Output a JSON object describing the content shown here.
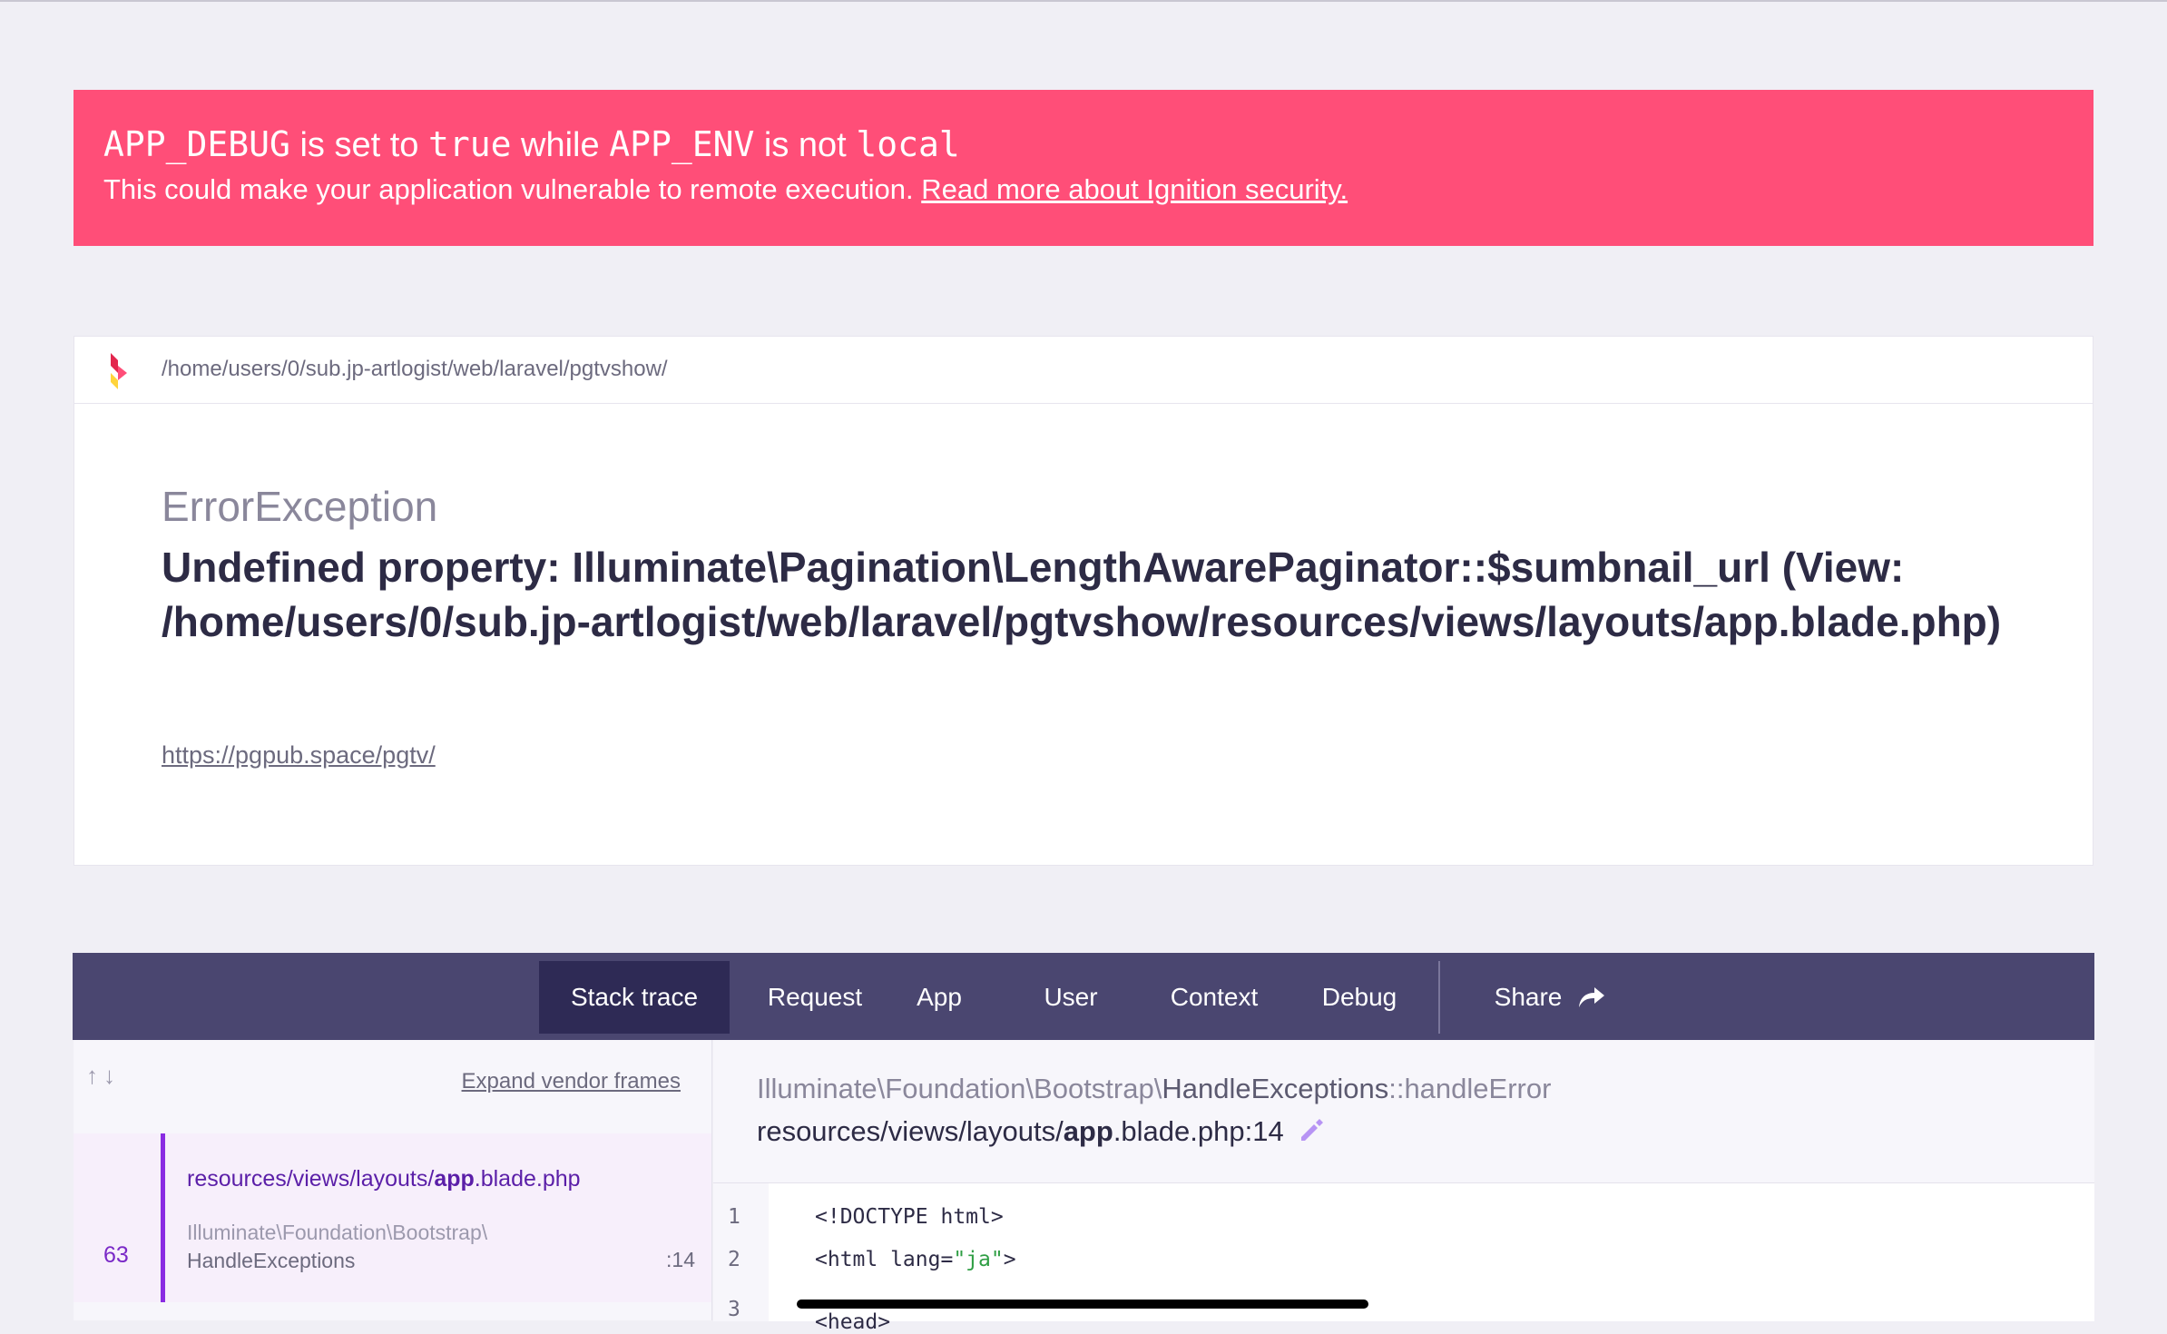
{
  "warning": {
    "code1": "APP_DEBUG",
    "text1": " is set to ",
    "code2": "true",
    "text2": " while ",
    "code3": "APP_ENV",
    "text3": " is not ",
    "code4": "local",
    "line2": "This could make your application vulnerable to remote execution.",
    "link": "Read more about Ignition security."
  },
  "error": {
    "path": "/home/users/0/sub.jp-artlogist/web/laravel/pgtvshow/",
    "exception_class": "ErrorException",
    "message": "Undefined property: Illuminate\\Pagination\\LengthAwarePaginator::$sumbnail_url (View: /home/users/0/sub.jp-artlogist/web/laravel/pgtvshow/resources/views/layouts/app.blade.php)",
    "url": "https://pgpub.space/pgtv/"
  },
  "tabs": {
    "stack_trace": "Stack trace",
    "request": "Request",
    "app": "App",
    "user": "User",
    "context": "Context",
    "debug": "Debug",
    "share": "Share"
  },
  "stack": {
    "arrows": "↑↓",
    "expand_vendor": "Expand vendor frames",
    "frame": {
      "file_prefix": "resources/views/layouts/",
      "file_bold": "app",
      "file_suffix": ".blade.php",
      "number": "63",
      "class_line1": "Illuminate\\Foundation\\Bootstrap\\",
      "class_line2": "HandleExceptions",
      "line": ":14"
    }
  },
  "detail": {
    "class_ns": "Illuminate\\Foundation\\Bootstrap\\",
    "class_name": "HandleExceptions",
    "method": "::handleError",
    "file_prefix": "resources/views/layouts/",
    "file_bold": "app",
    "file_suffix": ".blade.php:14"
  },
  "code": {
    "line1_no": "1",
    "line1": "<!DOCTYPE html>",
    "line2_no": "2",
    "line2_a": "<html lang=",
    "line2_str": "\"ja\"",
    "line2_b": ">",
    "line3_no": "3",
    "line3": "<head>"
  },
  "colors": {
    "banner": "#ff4e78",
    "tabs_bg": "#4a4670",
    "tab_active": "#2e2a55",
    "frame_accent": "#8a2be2"
  }
}
